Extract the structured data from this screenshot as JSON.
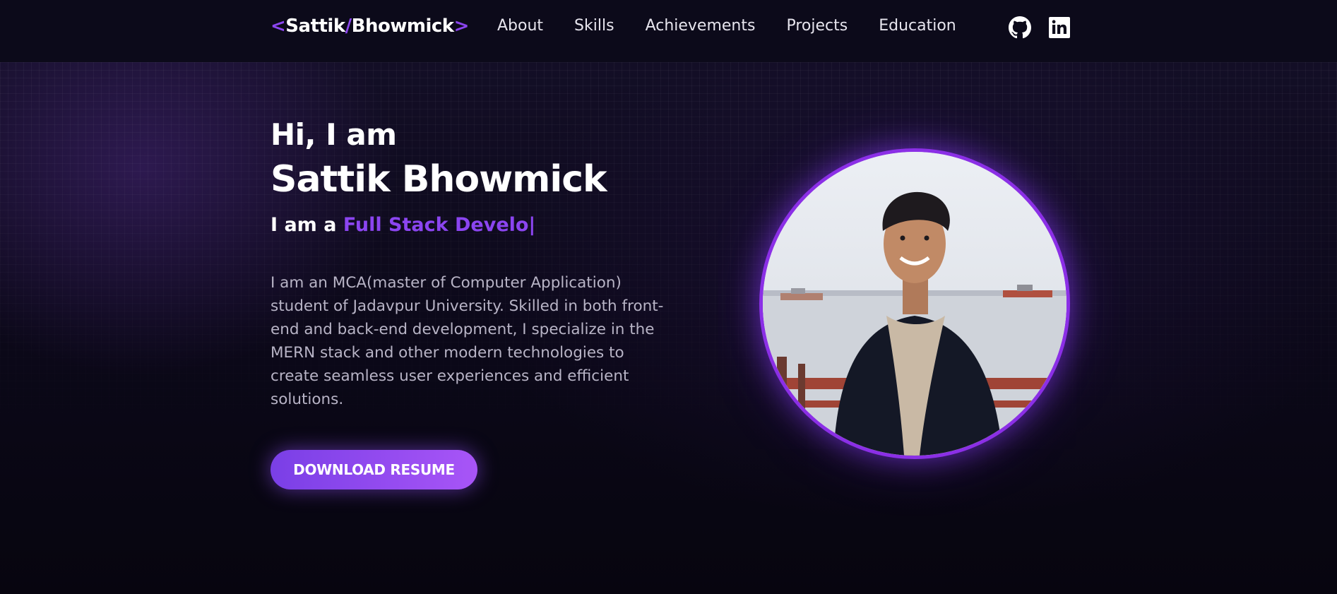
{
  "logo": {
    "open": "<",
    "first": "Sattik",
    "slash": "/",
    "last": "Bhowmick",
    "close": ">"
  },
  "nav": {
    "links": [
      "About",
      "Skills",
      "Achievements",
      "Projects",
      "Education"
    ]
  },
  "social": {
    "icons": [
      "github-icon",
      "linkedin-icon"
    ]
  },
  "hero": {
    "greeting": "Hi, I am",
    "name": "Sattik Bhowmick",
    "role_prefix": "I am a ",
    "role_typed": "Full Stack Develo|",
    "description": "I am an MCA(master of Computer Application) student of Jadavpur University. Skilled in both front-end and back-end development, I specialize in the MERN stack and other modern technologies to create seamless user experiences and efficient solutions.",
    "button_label": "DOWNLOAD RESUME"
  },
  "colors": {
    "accent": "#8b45f0",
    "background": "#0b0818",
    "ring": "#8b2fe6"
  }
}
